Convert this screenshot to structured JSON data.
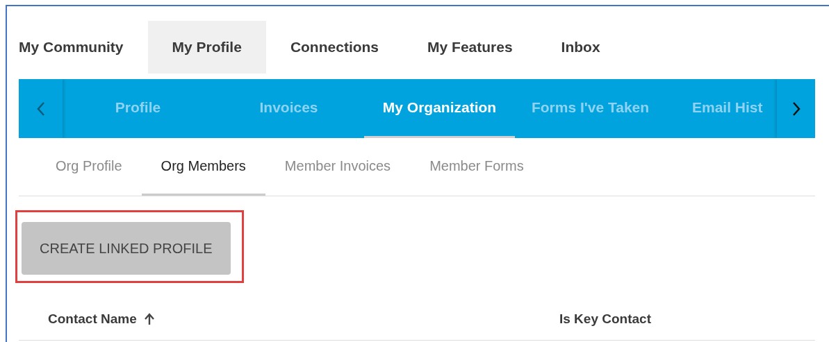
{
  "main_nav": [
    {
      "label": "My Community",
      "selected": false
    },
    {
      "label": "My Profile",
      "selected": true
    },
    {
      "label": "Connections",
      "selected": false
    },
    {
      "label": "My Features",
      "selected": false
    },
    {
      "label": "Inbox",
      "selected": false
    }
  ],
  "profile_tabs": [
    {
      "label": "Profile",
      "selected": false
    },
    {
      "label": "Invoices",
      "selected": false
    },
    {
      "label": "My Organization",
      "selected": true
    },
    {
      "label": "Forms I've Taken",
      "selected": false
    },
    {
      "label": "Email Hist",
      "selected": false
    }
  ],
  "org_tabs": [
    {
      "label": "Org Profile",
      "selected": false
    },
    {
      "label": "Org Members",
      "selected": true
    },
    {
      "label": "Member Invoices",
      "selected": false
    },
    {
      "label": "Member Forms",
      "selected": false
    }
  ],
  "create_button": {
    "label": "CREATE LINKED PROFILE",
    "highlighted": true
  },
  "table": {
    "columns": [
      {
        "label": "Contact Name",
        "sorted": true
      },
      {
        "label": "Is Key Contact",
        "sorted": false
      }
    ]
  }
}
